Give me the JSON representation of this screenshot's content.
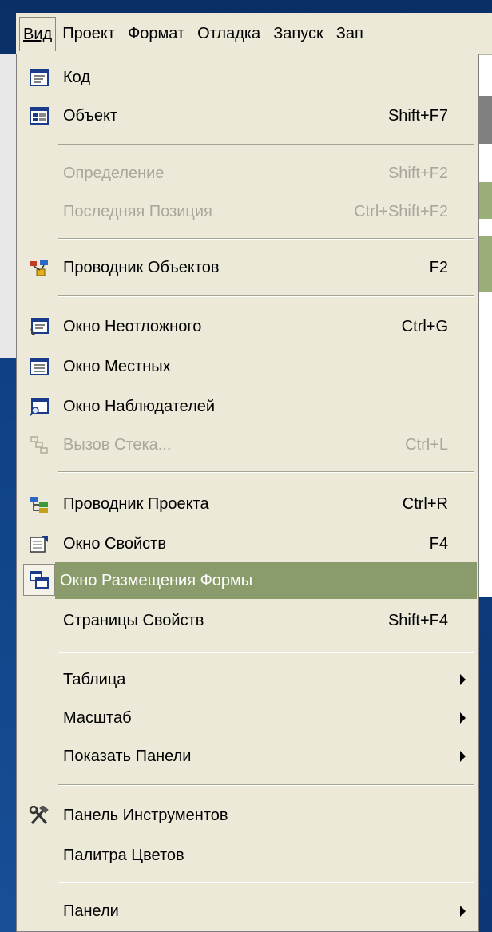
{
  "menubar": {
    "items": [
      "Вид",
      "Проект",
      "Формат",
      "Отладка",
      "Запуск",
      "Зап"
    ]
  },
  "menu": {
    "items": [
      {
        "label": "Код",
        "shortcut": "",
        "icon": "code-window-icon"
      },
      {
        "label": "Объект",
        "shortcut": "Shift+F7",
        "icon": "object-form-icon"
      },
      {
        "label": "Определение",
        "shortcut": "Shift+F2",
        "disabled": true
      },
      {
        "label": "Последняя Позиция",
        "shortcut": "Ctrl+Shift+F2",
        "disabled": true
      },
      {
        "label": "Проводник Объектов",
        "shortcut": "F2",
        "icon": "object-browser-icon"
      },
      {
        "label": "Окно Неотложного",
        "shortcut": "Ctrl+G",
        "icon": "immediate-window-icon"
      },
      {
        "label": "Окно Местных",
        "shortcut": "",
        "icon": "locals-window-icon"
      },
      {
        "label": "Окно Наблюдателей",
        "shortcut": "",
        "icon": "watch-window-icon"
      },
      {
        "label": "Вызов Стека...",
        "shortcut": "Ctrl+L",
        "disabled": true,
        "icon": "call-stack-icon"
      },
      {
        "label": "Проводник Проекта",
        "shortcut": "Ctrl+R",
        "icon": "project-explorer-icon"
      },
      {
        "label": "Окно Свойств",
        "shortcut": "F4",
        "icon": "properties-window-icon"
      },
      {
        "label": "Окно Размещения Формы",
        "shortcut": "",
        "highlighted": true,
        "icon": "form-layout-icon"
      },
      {
        "label": "Страницы Свойств",
        "shortcut": "Shift+F4"
      },
      {
        "label": "Таблица",
        "submenu": true
      },
      {
        "label": "Масштаб",
        "submenu": true
      },
      {
        "label": "Показать Панели",
        "submenu": true
      },
      {
        "label": "Панель Инструментов",
        "shortcut": "",
        "icon": "toolbox-icon"
      },
      {
        "label": "Палитра Цветов",
        "shortcut": ""
      },
      {
        "label": "Панели",
        "submenu": true
      }
    ]
  },
  "colors": {
    "menu_bg": "#ece9d8",
    "highlight": "#8b9c6c",
    "disabled_text": "#a9a79c",
    "slide_bg": "#0b3572"
  }
}
